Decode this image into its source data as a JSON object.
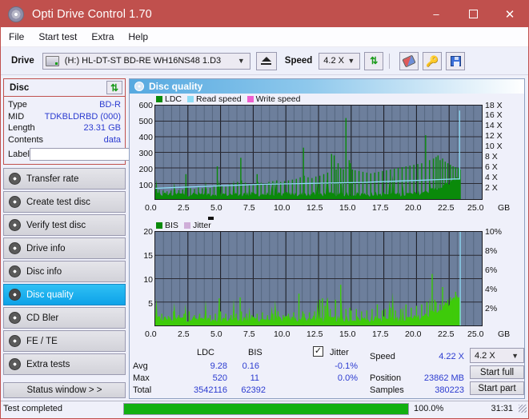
{
  "window": {
    "title": "Opti Drive Control 1.70",
    "icon": "disc-icon",
    "minimize": "–",
    "maximize": "□",
    "close": "✕"
  },
  "menu": {
    "items": [
      "File",
      "Start test",
      "Extra",
      "Help"
    ]
  },
  "toolbar": {
    "drive_label": "Drive",
    "drive_value": "(H:)  HL-DT-ST BD-RE  WH16NS48 1.D3",
    "eject_title": "Eject",
    "speed_label": "Speed",
    "speed_value": "4.2 X",
    "refresh_icon": "refresh-icon",
    "erase_icon": "eraser-icon",
    "key_icon": "key-icon",
    "save_icon": "save-icon"
  },
  "disc": {
    "header": "Disc",
    "refresh_icon": "refresh-icon",
    "rows": [
      {
        "key": "Type",
        "value": "BD-R"
      },
      {
        "key": "MID",
        "value": "TDKBLDRBD (000)"
      },
      {
        "key": "Length",
        "value": "23.31 GB"
      },
      {
        "key": "Contents",
        "value": "data"
      }
    ],
    "label_key": "Label",
    "label_value": "",
    "label_placeholder": "",
    "label_button_icon": "cd-icon"
  },
  "nav": {
    "items": [
      {
        "label": "Transfer rate",
        "active": false
      },
      {
        "label": "Create test disc",
        "active": false
      },
      {
        "label": "Verify test disc",
        "active": false
      },
      {
        "label": "Drive info",
        "active": false
      },
      {
        "label": "Disc info",
        "active": false
      },
      {
        "label": "Disc quality",
        "active": true
      },
      {
        "label": "CD Bler",
        "active": false
      },
      {
        "label": "FE / TE",
        "active": false
      },
      {
        "label": "Extra tests",
        "active": false
      }
    ],
    "status_window": "Status window > >"
  },
  "panel": {
    "title": "Disc quality",
    "icon": "disc-quality-icon"
  },
  "chart_data": [
    {
      "type": "area",
      "title": "LDC / Read speed",
      "legend": [
        {
          "label": "LDC",
          "color": "#0a8a0a"
        },
        {
          "label": "Read speed",
          "color": "#8ddcf5"
        },
        {
          "label": "Write speed",
          "color": "#ef5fd0"
        }
      ],
      "legend_position": "top-left",
      "grid": true,
      "xlabel": "GB",
      "x_ticks": [
        "0.0",
        "2.5",
        "5.0",
        "7.5",
        "10.0",
        "12.5",
        "15.0",
        "17.5",
        "20.0",
        "22.5",
        "25.0"
      ],
      "xlim": [
        0,
        25
      ],
      "ylabel": "LDC",
      "y_ticks": [
        "100",
        "200",
        "300",
        "400",
        "500",
        "600"
      ],
      "ylim": [
        0,
        600
      ],
      "y2label": "X",
      "y2_ticks": [
        "2 X",
        "4 X",
        "6 X",
        "8 X",
        "10 X",
        "12 X",
        "14 X",
        "16 X",
        "18 X"
      ],
      "y2lim": [
        0,
        19
      ],
      "plot_bg": "#6d7f9c",
      "series": [
        {
          "name": "LDC",
          "color": "#0a8a0a",
          "baseline_avg": 35,
          "x": [
            0.05,
            0.3,
            0.6,
            0.9,
            1.2,
            1.5,
            1.8,
            2.1,
            2.35,
            2.4,
            2.7,
            3.0,
            3.3,
            3.6,
            3.9,
            4.2,
            4.5,
            4.75,
            4.8,
            5.1,
            5.4,
            5.7,
            6.0,
            6.3,
            6.55,
            6.6,
            6.9,
            7.2,
            7.5,
            7.8,
            7.85,
            8.1,
            8.4,
            8.7,
            9.0,
            9.3,
            9.6,
            9.9,
            10.2,
            10.5,
            10.8,
            11.1,
            11.35,
            11.4,
            11.7,
            12.0,
            12.3,
            12.6,
            12.9,
            13.2,
            13.5,
            13.7,
            13.85,
            14.0,
            14.2,
            14.4,
            14.6,
            14.85,
            14.95,
            15.1,
            15.3,
            15.6,
            15.9,
            16.2,
            16.5,
            16.8,
            17.1,
            17.4,
            17.7,
            18.0,
            18.3,
            18.6,
            18.9,
            19.2,
            19.5,
            19.8,
            20.1,
            20.4,
            20.7,
            21.0,
            21.3,
            21.5,
            21.65,
            21.8,
            22.0,
            22.2,
            22.4,
            22.6,
            22.8,
            23.0,
            23.2,
            23.35
          ],
          "y": [
            70,
            60,
            55,
            50,
            55,
            60,
            58,
            62,
            160,
            80,
            70,
            65,
            75,
            70,
            68,
            72,
            80,
            210,
            90,
            85,
            80,
            95,
            100,
            110,
            265,
            120,
            105,
            95,
            90,
            160,
            110,
            105,
            100,
            110,
            115,
            120,
            110,
            115,
            120,
            125,
            130,
            140,
            330,
            150,
            140,
            135,
            145,
            150,
            160,
            170,
            290,
            280,
            190,
            230,
            200,
            190,
            520,
            250,
            230,
            190,
            185,
            180,
            175,
            170,
            165,
            170,
            175,
            180,
            185,
            190,
            195,
            200,
            205,
            210,
            215,
            220,
            225,
            230,
            410,
            250,
            260,
            270,
            280,
            250,
            260,
            240,
            230,
            220,
            210,
            205,
            200,
            190
          ]
        },
        {
          "name": "Read speed",
          "color": "#8ddcf5",
          "units": "X",
          "x": [
            0.0,
            1.0,
            2.0,
            3.0,
            4.0,
            5.0,
            6.0,
            7.0,
            8.0,
            9.0,
            10.0,
            11.0,
            12.0,
            13.0,
            14.0,
            15.0,
            16.0,
            17.0,
            18.0,
            19.0,
            20.0,
            21.0,
            22.0,
            23.0,
            23.3,
            23.3
          ],
          "y": [
            2.2,
            2.3,
            2.4,
            2.5,
            2.6,
            2.7,
            2.8,
            2.9,
            3.0,
            3.05,
            3.1,
            3.15,
            3.2,
            3.25,
            3.3,
            3.35,
            3.4,
            3.5,
            3.6,
            3.7,
            3.8,
            3.9,
            4.0,
            4.1,
            4.1,
            18.0
          ]
        },
        {
          "name": "Write speed",
          "color": "#ef5fd0",
          "x": [],
          "y": []
        }
      ]
    },
    {
      "type": "area",
      "title": "BIS / Jitter",
      "legend": [
        {
          "label": "BIS",
          "color": "#0a8a0a"
        },
        {
          "label": "Jitter",
          "color": "#cfaed8"
        }
      ],
      "legend_position": "top-left",
      "grid": true,
      "xlabel": "GB",
      "x_ticks": [
        "0.0",
        "2.5",
        "5.0",
        "7.5",
        "10.0",
        "12.5",
        "15.0",
        "17.5",
        "20.0",
        "22.5",
        "25.0"
      ],
      "xlim": [
        0,
        25
      ],
      "ylabel": "BIS",
      "y_ticks": [
        "5",
        "10",
        "15",
        "20"
      ],
      "ylim": [
        0,
        20
      ],
      "y2label": "%",
      "y2_ticks": [
        "2%",
        "4%",
        "6%",
        "8%",
        "10%"
      ],
      "y2lim": [
        0,
        10
      ],
      "plot_bg": "#6d7f9c",
      "series": [
        {
          "name": "BIS",
          "color": "#3ecb0a",
          "baseline_avg": 1.6,
          "x": [
            0.1,
            0.5,
            1.0,
            1.4,
            1.8,
            2.2,
            2.6,
            3.0,
            3.4,
            3.8,
            4.2,
            4.6,
            4.9,
            5.0,
            5.4,
            5.8,
            6.2,
            6.5,
            6.6,
            7.0,
            7.4,
            7.8,
            8.2,
            8.6,
            9.0,
            9.4,
            9.8,
            10.2,
            10.6,
            11.0,
            11.3,
            11.4,
            11.8,
            12.2,
            12.6,
            12.8,
            13.0,
            13.4,
            13.8,
            14.2,
            14.6,
            14.9,
            15.0,
            15.4,
            15.8,
            16.2,
            16.6,
            17.0,
            17.4,
            17.6,
            18.0,
            18.4,
            18.8,
            19.2,
            19.6,
            20.0,
            20.4,
            20.8,
            21.2,
            21.4,
            21.5,
            21.8,
            22.0,
            22.2,
            22.4,
            22.6,
            22.8,
            23.0,
            23.2,
            23.35
          ],
          "y": [
            2,
            2.5,
            2,
            3,
            2.2,
            2.5,
            3,
            2.2,
            2.5,
            2,
            2.2,
            2.5,
            5.8,
            3,
            2.5,
            2.2,
            2.5,
            6.0,
            3,
            2.5,
            2.2,
            2.5,
            2.8,
            2.2,
            2.5,
            3,
            2.2,
            2.5,
            2.8,
            6.8,
            3,
            2.5,
            2.8,
            3,
            5.5,
            5.8,
            4.2,
            3.5,
            5.5,
            8.7,
            3.5,
            3.8,
            3.2,
            3.5,
            3,
            3.2,
            3.5,
            4.5,
            3.2,
            3.5,
            3.8,
            3.2,
            3.5,
            4.5,
            3.8,
            4.2,
            4.5,
            5.0,
            11.0,
            5.5,
            5.0,
            4.5,
            8.2,
            5.0,
            5.5,
            6.0,
            5.5,
            7.2,
            6.0,
            5.0
          ]
        },
        {
          "name": "Jitter",
          "color": "#cfaed8",
          "units": "%",
          "x": [],
          "y": []
        }
      ]
    }
  ],
  "stats": {
    "columns": [
      "LDC",
      "BIS"
    ],
    "jitter_label": "Jitter",
    "jitter_checked": true,
    "rows": [
      {
        "label": "Avg",
        "ldc": "9.28",
        "bis": "0.16",
        "jitter": "-0.1%"
      },
      {
        "label": "Max",
        "ldc": "520",
        "bis": "11",
        "jitter": "0.0%"
      },
      {
        "label": "Total",
        "ldc": "3542116",
        "bis": "62392",
        "jitter": ""
      }
    ],
    "speed_label": "Speed",
    "speed_value": "4.22 X",
    "position_label": "Position",
    "position_value": "23862 MB",
    "samples_label": "Samples",
    "samples_value": "380223",
    "speed_select": "4.2 X",
    "start_full": "Start full",
    "start_part": "Start part"
  },
  "footer": {
    "status": "Test completed",
    "progress_percent": 100.0,
    "progress_text": "100.0%",
    "elapsed": "31:31"
  }
}
